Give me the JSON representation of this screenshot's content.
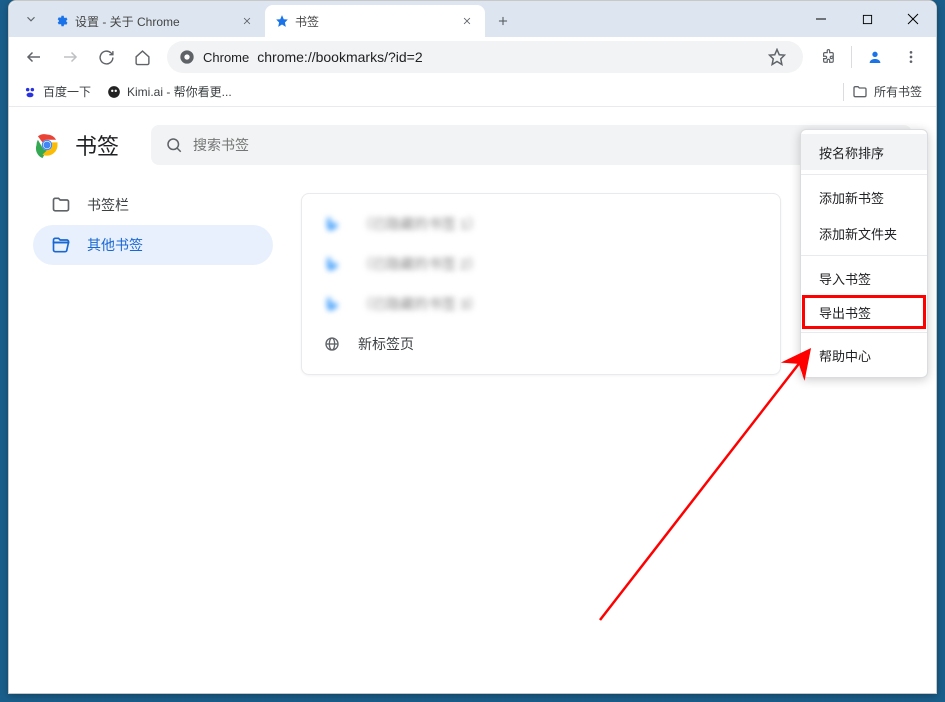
{
  "tabs": [
    {
      "title": "设置 - 关于 Chrome",
      "icon": "gear"
    },
    {
      "title": "书签",
      "icon": "star"
    }
  ],
  "address": {
    "scheme_label": "Chrome",
    "url": "chrome://bookmarks/?id=2"
  },
  "bookmark_bar": {
    "items": [
      {
        "label": "百度一下"
      },
      {
        "label": "Kimi.ai - 帮你看更..."
      }
    ],
    "all_label": "所有书签"
  },
  "page": {
    "title": "书签",
    "search_placeholder": "搜索书签"
  },
  "sidebar": {
    "items": [
      {
        "label": "书签栏",
        "active": false
      },
      {
        "label": "其他书签",
        "active": true
      }
    ]
  },
  "list": {
    "items": [
      {
        "label": "（已隐藏的书签 1）",
        "icon": "bing",
        "blur": true
      },
      {
        "label": "（已隐藏的书签 2）",
        "icon": "bing",
        "blur": true
      },
      {
        "label": "（已隐藏的书签 3）",
        "icon": "bing",
        "blur": true
      },
      {
        "label": "新标签页",
        "icon": "globe",
        "blur": false
      }
    ]
  },
  "menu": {
    "sort": "按名称排序",
    "add_bookmark": "添加新书签",
    "add_folder": "添加新文件夹",
    "import": "导入书签",
    "export": "导出书签",
    "help": "帮助中心"
  }
}
